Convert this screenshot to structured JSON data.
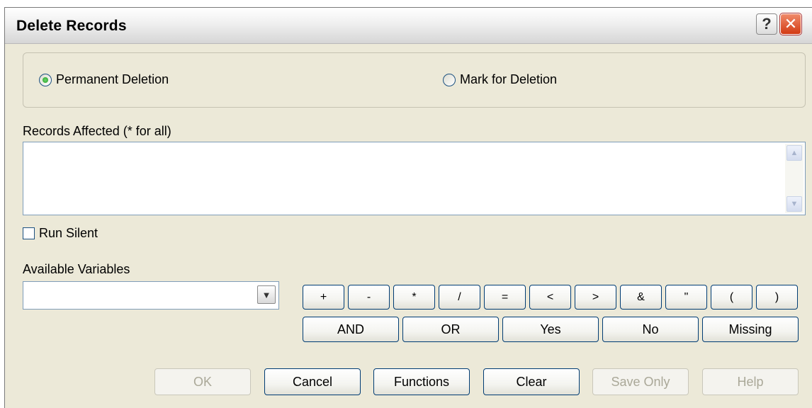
{
  "window": {
    "title": "Delete Records",
    "help_glyph": "?",
    "close_glyph": "✕"
  },
  "deletion_mode": {
    "options": [
      {
        "label": "Permanent Deletion",
        "selected": true
      },
      {
        "label": "Mark for Deletion",
        "selected": false
      }
    ]
  },
  "records_affected": {
    "label": "Records Affected (* for all)",
    "value": ""
  },
  "run_silent": {
    "label": "Run Silent",
    "checked": false
  },
  "available_variables": {
    "label": "Available Variables",
    "selected": ""
  },
  "operators": {
    "symbols": [
      "+",
      "-",
      "*",
      "/",
      "=",
      "<",
      ">",
      "&",
      "\"",
      "(",
      ")"
    ],
    "words": [
      "AND",
      "OR",
      "Yes",
      "No",
      "Missing"
    ]
  },
  "footer": {
    "ok": "OK",
    "cancel": "Cancel",
    "functions": "Functions",
    "clear": "Clear",
    "save_only": "Save Only",
    "help": "Help"
  },
  "colors": {
    "dialog_bg": "#ece9d8",
    "button_border": "#003c74",
    "field_border": "#7f9db9",
    "radio_selected": "#21a121"
  },
  "icons": {
    "help": "question-icon",
    "close": "close-icon",
    "scroll_up": "chevron-up-icon",
    "scroll_down": "chevron-down-icon",
    "dropdown": "chevron-down-icon"
  }
}
